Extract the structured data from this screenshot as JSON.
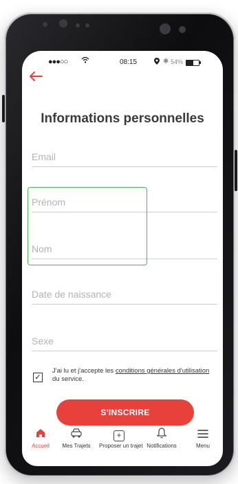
{
  "status": {
    "signal": "●●●○○",
    "wifi_icon": "wifi-icon",
    "time": "08:15",
    "location_icon": "location-icon",
    "bluetooth_icon": "bluetooth-icon",
    "battery_percent": "54%",
    "battery_level": 0.54
  },
  "header": {
    "back_icon": "back-arrow-icon"
  },
  "page": {
    "title": "Informations personnelles"
  },
  "form": {
    "email": {
      "value": "",
      "placeholder": "Email"
    },
    "prenom": {
      "value": "",
      "placeholder": "Prénom"
    },
    "nom": {
      "value": "",
      "placeholder": "Nom"
    },
    "naissance": {
      "value": "",
      "placeholder": "Date de naissance"
    },
    "sexe": {
      "value": "",
      "placeholder": "Sexe"
    }
  },
  "terms": {
    "checked": true,
    "prefix": "J'ai lu et j'accepte les ",
    "link": "conditions générales d'utilisation",
    "suffix": " du service."
  },
  "cta": {
    "label": "S'INSCRIRE"
  },
  "tabs": [
    {
      "label": "Accueil",
      "icon": "home-icon",
      "active": true
    },
    {
      "label": "Mes Trajets",
      "icon": "car-icon",
      "active": false
    },
    {
      "label": "Proposer un trajet",
      "icon": "plus-box-icon",
      "active": false
    },
    {
      "label": "Notifications",
      "icon": "bell-icon",
      "active": false
    },
    {
      "label": "Menu",
      "icon": "hamburger-icon",
      "active": false
    }
  ],
  "colors": {
    "accent": "#e8403a",
    "highlight": "#4fb35c"
  }
}
